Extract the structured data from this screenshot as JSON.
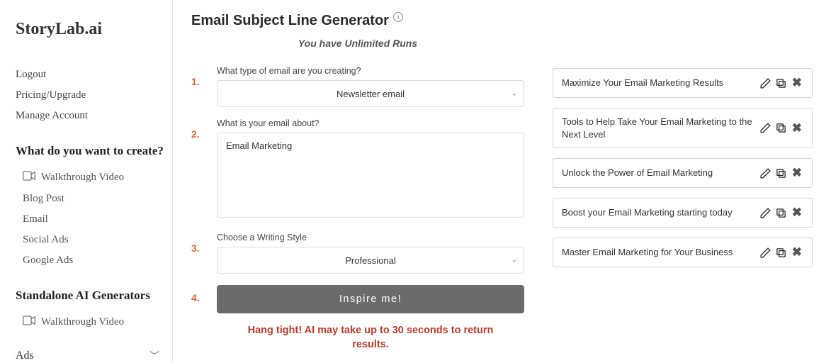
{
  "brand": "StoryLab.ai",
  "sidebar": {
    "links": [
      "Logout",
      "Pricing/Upgrade",
      "Manage Account"
    ],
    "create_heading": "What do you want to create?",
    "create_items": [
      {
        "label": "Walkthrough Video",
        "icon": "video"
      },
      {
        "label": "Blog Post"
      },
      {
        "label": "Email"
      },
      {
        "label": "Social Ads"
      },
      {
        "label": "Google Ads"
      }
    ],
    "standalone_heading": "Standalone AI Generators",
    "standalone_items": [
      {
        "label": "Walkthrough Video",
        "icon": "video"
      }
    ],
    "collapsible": "Ads"
  },
  "page": {
    "title": "Email Subject Line Generator",
    "runs_message": "You have Unlimited Runs"
  },
  "form": {
    "steps": {
      "type": {
        "num": "1.",
        "label": "What type of email are you creating?",
        "value": "Newsletter email"
      },
      "about": {
        "num": "2.",
        "label": "What is your email about?",
        "value": "Email Marketing"
      },
      "style": {
        "num": "3.",
        "label": "Choose a Writing Style",
        "value": "Professional"
      },
      "submit": {
        "num": "4.",
        "button": "Inspire me!"
      }
    },
    "wait_message": "Hang tight! AI may take up to 30 seconds to return results."
  },
  "results": [
    "Maximize Your Email Marketing Results",
    "Tools to Help Take Your Email Marketing to the Next Level",
    "Unlock the Power of Email Marketing",
    "Boost your Email Marketing starting today",
    "Master Email Marketing for Your Business"
  ]
}
